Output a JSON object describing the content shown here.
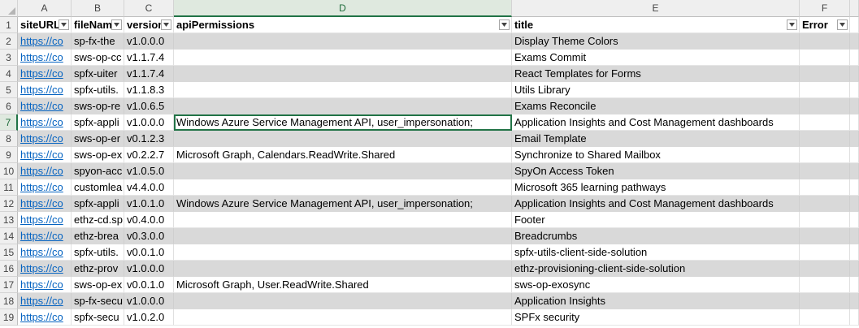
{
  "columns": [
    "A",
    "B",
    "C",
    "D",
    "E",
    "F"
  ],
  "headers": {
    "row_num": "1",
    "siteURL": "siteURL",
    "fileName": "fileName",
    "version": "version",
    "apiPermissions": "apiPermissions",
    "title": "title",
    "error": "Error"
  },
  "rows": [
    {
      "num": "2",
      "site": "https://co",
      "file": "sp-fx-the",
      "version": "v1.0.0.0",
      "api": "",
      "title": "Display Theme Colors"
    },
    {
      "num": "3",
      "site": "https://co",
      "file": "sws-op-cc",
      "version": "v1.1.7.4",
      "api": "",
      "title": "Exams Commit"
    },
    {
      "num": "4",
      "site": "https://co",
      "file": "spfx-uiter",
      "version": "v1.1.7.4",
      "api": "",
      "title": "React Templates for Forms"
    },
    {
      "num": "5",
      "site": "https://co",
      "file": "spfx-utils.",
      "version": "v1.1.8.3",
      "api": "",
      "title": "Utils Library"
    },
    {
      "num": "6",
      "site": "https://co",
      "file": "sws-op-re",
      "version": "v1.0.6.5",
      "api": "",
      "title": "Exams Reconcile"
    },
    {
      "num": "7",
      "site": "https://co",
      "file": "spfx-appli",
      "version": "v1.0.0.0",
      "api": "Windows Azure Service Management API, user_impersonation;",
      "title": "Application Insights and Cost Management dashboards"
    },
    {
      "num": "8",
      "site": "https://co",
      "file": "sws-op-er",
      "version": "v0.1.2.3",
      "api": "",
      "title": "Email Template"
    },
    {
      "num": "9",
      "site": "https://co",
      "file": "sws-op-ex",
      "version": "v0.2.2.7",
      "api": "Microsoft Graph, Calendars.ReadWrite.Shared",
      "title": "Synchronize to Shared Mailbox"
    },
    {
      "num": "10",
      "site": "https://co",
      "file": "spyon-acc",
      "version": "v1.0.5.0",
      "api": "",
      "title": "SpyOn Access Token"
    },
    {
      "num": "11",
      "site": "https://co",
      "file": "customlea",
      "version": "v4.4.0.0",
      "api": "",
      "title": "Microsoft 365 learning pathways"
    },
    {
      "num": "12",
      "site": "https://co",
      "file": "spfx-appli",
      "version": "v1.0.1.0",
      "api": "Windows Azure Service Management API, user_impersonation;",
      "title": "Application Insights and Cost Management dashboards"
    },
    {
      "num": "13",
      "site": "https://co",
      "file": "ethz-cd.sp",
      "version": "v0.4.0.0",
      "api": "",
      "title": "Footer"
    },
    {
      "num": "14",
      "site": "https://co",
      "file": "ethz-brea",
      "version": "v0.3.0.0",
      "api": "",
      "title": "Breadcrumbs"
    },
    {
      "num": "15",
      "site": "https://co",
      "file": "spfx-utils.",
      "version": "v0.0.1.0",
      "api": "",
      "title": "spfx-utils-client-side-solution"
    },
    {
      "num": "16",
      "site": "https://co",
      "file": "ethz-prov",
      "version": "v1.0.0.0",
      "api": "",
      "title": "ethz-provisioning-client-side-solution"
    },
    {
      "num": "17",
      "site": "https://co",
      "file": "sws-op-ex",
      "version": "v0.0.1.0",
      "api": "Microsoft Graph, User.ReadWrite.Shared",
      "title": "sws-op-exosync"
    },
    {
      "num": "18",
      "site": "https://co",
      "file": "sp-fx-secu",
      "version": "v1.0.0.0",
      "api": "",
      "title": "Application Insights"
    },
    {
      "num": "19",
      "site": "https://co",
      "file": "spfx-secu",
      "version": "v1.0.2.0",
      "api": "",
      "title": "SPFx security"
    }
  ],
  "selected_cell": "D7",
  "active_column": "D",
  "active_row": "7",
  "colors": {
    "accent": "#217346",
    "link": "#0563c1",
    "band": "#d9d9d9"
  }
}
